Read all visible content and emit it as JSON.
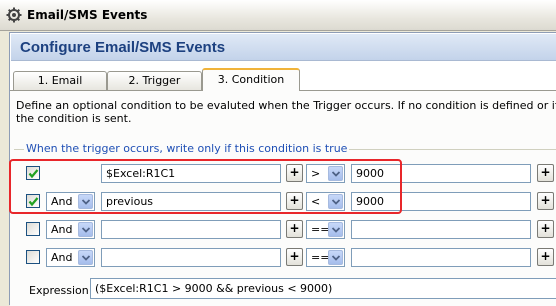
{
  "window": {
    "title": "Email/SMS Events",
    "icon": "gear-icon"
  },
  "header": {
    "title": "Configure Email/SMS Events"
  },
  "tabs": [
    {
      "label": "1. Email",
      "active": false
    },
    {
      "label": "2. Trigger",
      "active": false
    },
    {
      "label": "3. Condition",
      "active": true
    }
  ],
  "condition": {
    "description": "Define an optional condition to be evaluted when the Trigger occurs.  If no condition is defined or if the condition is sent.",
    "group_label": "When the trigger occurs, write only if this condition is true",
    "add_label": "+",
    "rows": [
      {
        "checked": true,
        "logic": "",
        "left": "$Excel:R1C1",
        "operator": ">",
        "right": "9000"
      },
      {
        "checked": true,
        "logic": "And",
        "left": "previous",
        "operator": "<",
        "right": "9000"
      },
      {
        "checked": false,
        "logic": "And",
        "left": "",
        "operator": "==",
        "right": ""
      },
      {
        "checked": false,
        "logic": "And",
        "left": "",
        "operator": "==",
        "right": ""
      }
    ],
    "expression_label": "Expression:",
    "expression_value": "($Excel:R1C1 > 9000 && previous < 9000)"
  },
  "colors": {
    "header_text": "#1d4180",
    "group_label": "#1f4fb5",
    "highlight": "#e8262a",
    "active_tab_accent": "#f0b33a"
  }
}
